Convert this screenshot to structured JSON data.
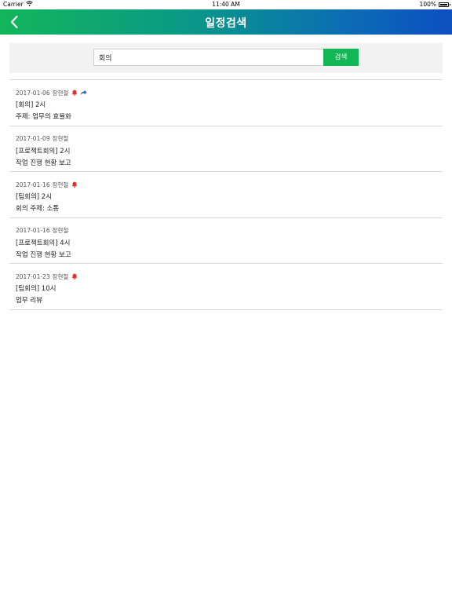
{
  "status_bar": {
    "carrier": "Carrier",
    "time": "11:40 AM",
    "battery": "100%"
  },
  "nav": {
    "title": "일정검색",
    "back_icon": "chevron-left-icon"
  },
  "search": {
    "value": "회의",
    "button_label": "검색"
  },
  "colors": {
    "accent_green": "#12b654",
    "bell_red": "#e0302f",
    "share_blue": "#2a5bd0"
  },
  "results": [
    {
      "date": "2017-01-06",
      "author": "장현철",
      "alarm": true,
      "shared": true,
      "title": "[회의] 2시",
      "subject": "주제: 업무의 효율화"
    },
    {
      "date": "2017-01-09",
      "author": "장현철",
      "alarm": false,
      "shared": false,
      "title": "[프로젝트회의] 2시",
      "subject": "작업 진행 현황 보고"
    },
    {
      "date": "2017-01-16",
      "author": "장현철",
      "alarm": true,
      "shared": false,
      "title": "[팀회의] 2시",
      "subject": "회의 주제: 소통"
    },
    {
      "date": "2017-01-16",
      "author": "장현철",
      "alarm": false,
      "shared": false,
      "title": "[프로젝트회의] 4시",
      "subject": "작업 진행 현황 보고"
    },
    {
      "date": "2017-01-23",
      "author": "장현철",
      "alarm": true,
      "shared": false,
      "title": "[팀회의] 10시",
      "subject": "업무 리뷰"
    }
  ]
}
